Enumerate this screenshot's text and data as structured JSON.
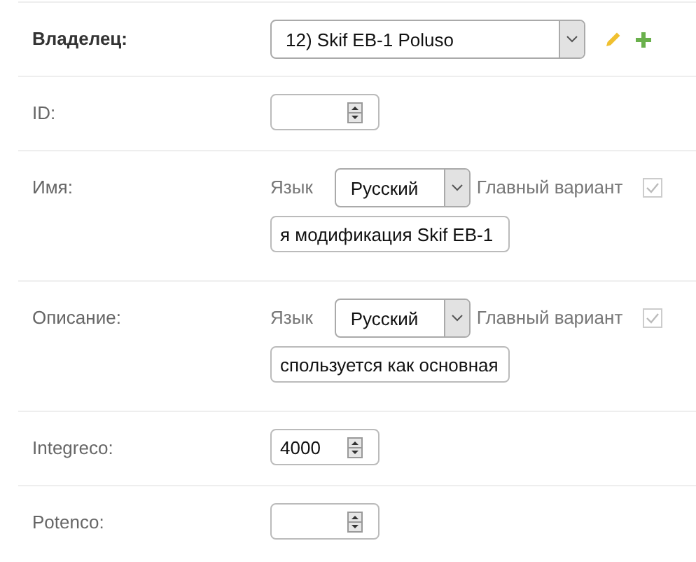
{
  "fields": [
    {
      "kind": "select",
      "label": "Владелец:",
      "bold": true,
      "value": "12) Skif EB-1 Poluso",
      "actions": [
        {
          "kind": "edit"
        },
        {
          "kind": "add"
        }
      ]
    },
    {
      "kind": "number",
      "label": "ID:",
      "bold": false
    },
    {
      "kind": "translated",
      "label": "Имя:",
      "bold": false,
      "language_label": "Язык",
      "language": "Русский",
      "main_label": "Главный вариант",
      "main_checked": true,
      "main_disabled": true,
      "value": "я модификация Skif EB-1"
    },
    {
      "kind": "translated",
      "label": "Описание:",
      "bold": false,
      "language_label": "Язык",
      "language": "Русский",
      "main_label": "Главный вариант",
      "main_checked": true,
      "main_disabled": true,
      "value": "спользуется как основная"
    },
    {
      "kind": "number",
      "label": "Integreco:",
      "bold": false,
      "value": "4000"
    },
    {
      "kind": "number",
      "label": "Potenco:",
      "bold": false
    }
  ]
}
